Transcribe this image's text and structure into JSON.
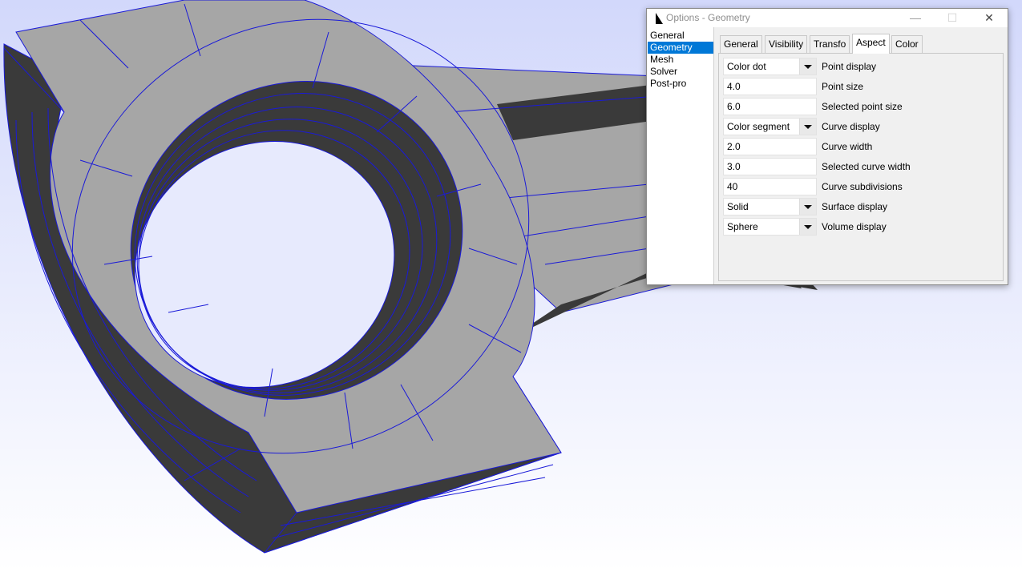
{
  "window": {
    "title": "Options - Geometry",
    "minimize_glyph": "—",
    "maximize_glyph": "☐",
    "close_glyph": "✕"
  },
  "categories": [
    {
      "label": "General",
      "selected": false
    },
    {
      "label": "Geometry",
      "selected": true
    },
    {
      "label": "Mesh",
      "selected": false
    },
    {
      "label": "Solver",
      "selected": false
    },
    {
      "label": "Post-pro",
      "selected": false
    }
  ],
  "tabs": [
    {
      "label": "General",
      "active": false
    },
    {
      "label": "Visibility",
      "active": false
    },
    {
      "label": "Transfo",
      "active": false
    },
    {
      "label": "Aspect",
      "active": true
    },
    {
      "label": "Color",
      "active": false
    }
  ],
  "aspect": {
    "point_display": {
      "value": "Color dot",
      "label": "Point display"
    },
    "point_size": {
      "value": "4.0",
      "label": "Point size"
    },
    "selected_point_size": {
      "value": "6.0",
      "label": "Selected point size"
    },
    "curve_display": {
      "value": "Color segment",
      "label": "Curve display"
    },
    "curve_width": {
      "value": "2.0",
      "label": "Curve width"
    },
    "selected_curve_width": {
      "value": "3.0",
      "label": "Selected curve width"
    },
    "curve_subdivisions": {
      "value": "40",
      "label": "Curve subdivisions"
    },
    "surface_display": {
      "value": "Solid",
      "label": "Surface display"
    },
    "volume_display": {
      "value": "Sphere",
      "label": "Volume display"
    }
  },
  "colors": {
    "background_top": "#d2d8fb",
    "background_bottom": "#ffffff",
    "surface": "#a6a6a6",
    "side": "#3a3a3a",
    "curve": "#1a1ad8",
    "selection": "#0078d7"
  }
}
